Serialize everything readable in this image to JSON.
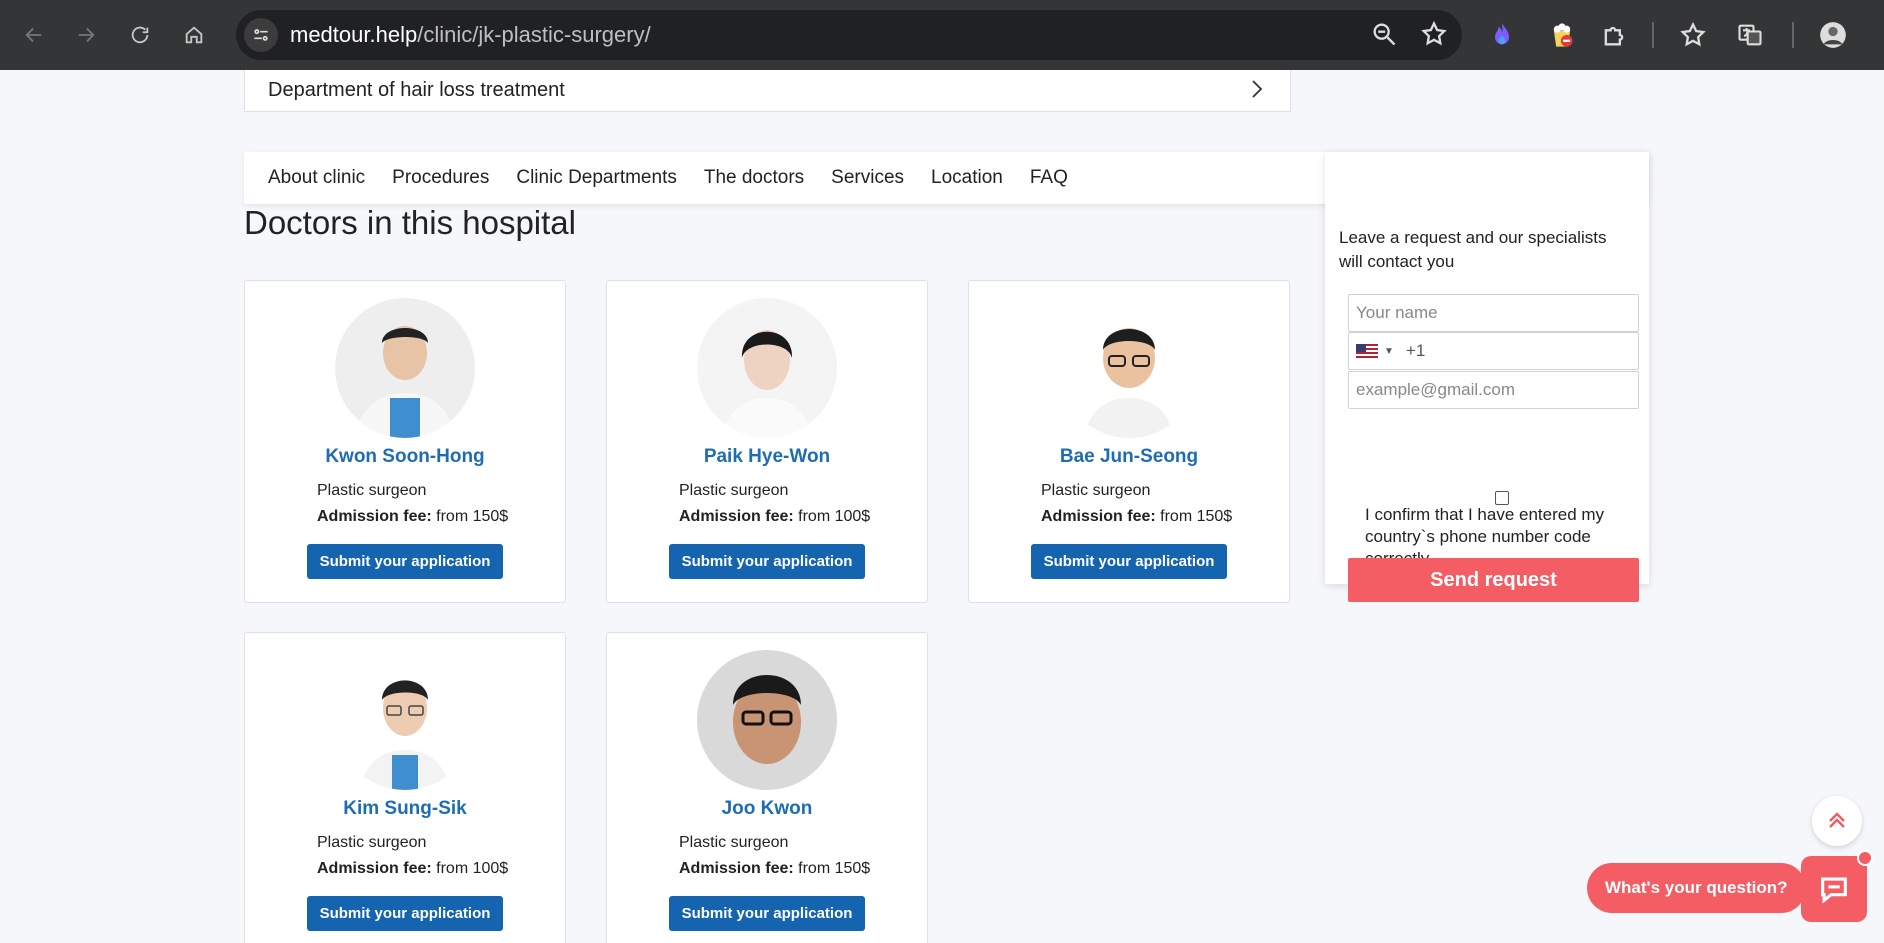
{
  "browser": {
    "url_domain": "medtour.help",
    "url_path": "/clinic/jk-plastic-surgery/"
  },
  "department_row": {
    "label": "Department of hair loss treatment"
  },
  "tabs": [
    {
      "label": "About clinic"
    },
    {
      "label": "Procedures"
    },
    {
      "label": "Clinic Departments"
    },
    {
      "label": "The doctors"
    },
    {
      "label": "Services"
    },
    {
      "label": "Location"
    },
    {
      "label": "FAQ"
    }
  ],
  "doctors_section": {
    "title": "Doctors in this hospital",
    "fee_label": "Admission fee:",
    "doctors": [
      {
        "name": "Kwon Soon-Hong",
        "role": "Plastic surgeon",
        "fee": "from 150$",
        "button": "Submit your application"
      },
      {
        "name": "Paik Hye-Won",
        "role": "Plastic surgeon",
        "fee": "from 100$",
        "button": "Submit your application"
      },
      {
        "name": "Bae Jun-Seong",
        "role": "Plastic surgeon",
        "fee": "from 150$",
        "button": "Submit your application"
      },
      {
        "name": "Kim Sung-Sik",
        "role": "Plastic surgeon",
        "fee": "from 100$",
        "button": "Submit your application"
      },
      {
        "name": "Joo Kwon",
        "role": "Plastic surgeon",
        "fee": "from 150$",
        "button": "Submit your application"
      }
    ]
  },
  "request_form": {
    "intro": "Leave a request and our specialists will contact you",
    "name_placeholder": "Your name",
    "phone_code": "+1",
    "email_placeholder": "example@gmail.com",
    "confirm_text": "I confirm that I have entered my country`s phone number code correctly",
    "send_label": "Send request"
  },
  "widgets": {
    "question_label": "What's your question?"
  },
  "colors": {
    "accent": "#f35d63",
    "link_blue": "#1e6db4",
    "button_blue": "#1464b0"
  }
}
